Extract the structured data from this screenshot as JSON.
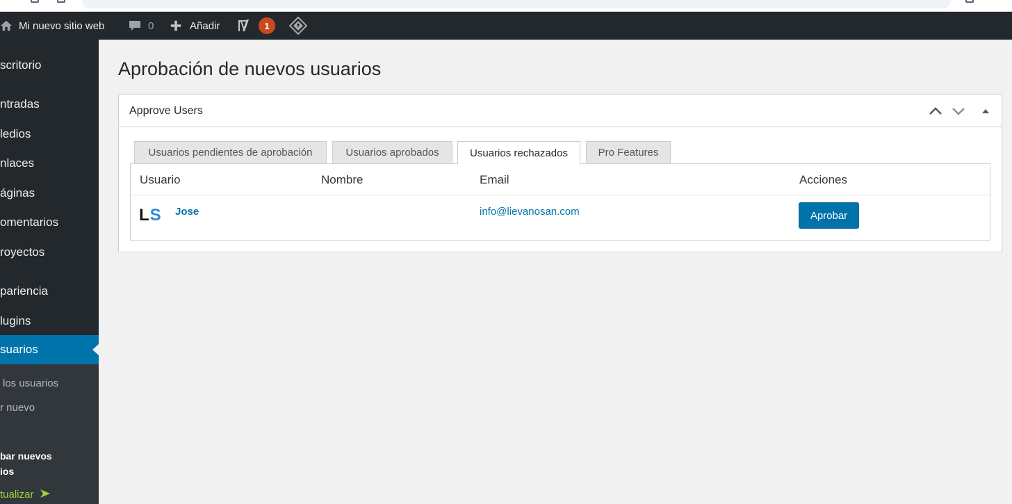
{
  "adminbar": {
    "site_name": "Mi nuevo sitio web",
    "comments_count": "0",
    "add_label": "Añadir",
    "yoast_badge": "1"
  },
  "sidebar": {
    "items": [
      {
        "label": "scritorio"
      },
      {
        "label": "ntradas"
      },
      {
        "label": "ledios"
      },
      {
        "label": "nlaces"
      },
      {
        "label": "áginas"
      },
      {
        "label": "omentarios"
      },
      {
        "label": "royectos"
      },
      {
        "label": "pariencia"
      },
      {
        "label": "lugins"
      },
      {
        "label": "suarios"
      }
    ],
    "submenu": {
      "all_users": "los usuarios",
      "add_new": "r nuevo",
      "approve_line1": "bar nuevos",
      "approve_line2": "ios",
      "update": "tualizar"
    }
  },
  "page": {
    "title": "Aprobación de nuevos usuarios"
  },
  "postbox": {
    "title": "Approve Users",
    "tabs": [
      {
        "label": "Usuarios pendientes de aprobación"
      },
      {
        "label": "Usuarios aprobados"
      },
      {
        "label": "Usuarios rechazados"
      },
      {
        "label": "Pro Features"
      }
    ],
    "table": {
      "headers": {
        "user": "Usuario",
        "name": "Nombre",
        "email": "Email",
        "actions": "Acciones"
      },
      "rows": [
        {
          "avatar": {
            "l": "L",
            "s": "S"
          },
          "username": "Jose",
          "name": "",
          "email": "info@lievanosan.com",
          "action_label": "Aprobar"
        }
      ]
    }
  },
  "colors": {
    "admin_dark": "#23282d",
    "primary": "#0073aa",
    "badge": "#ca4a1f",
    "update_green": "#9ed33b"
  }
}
